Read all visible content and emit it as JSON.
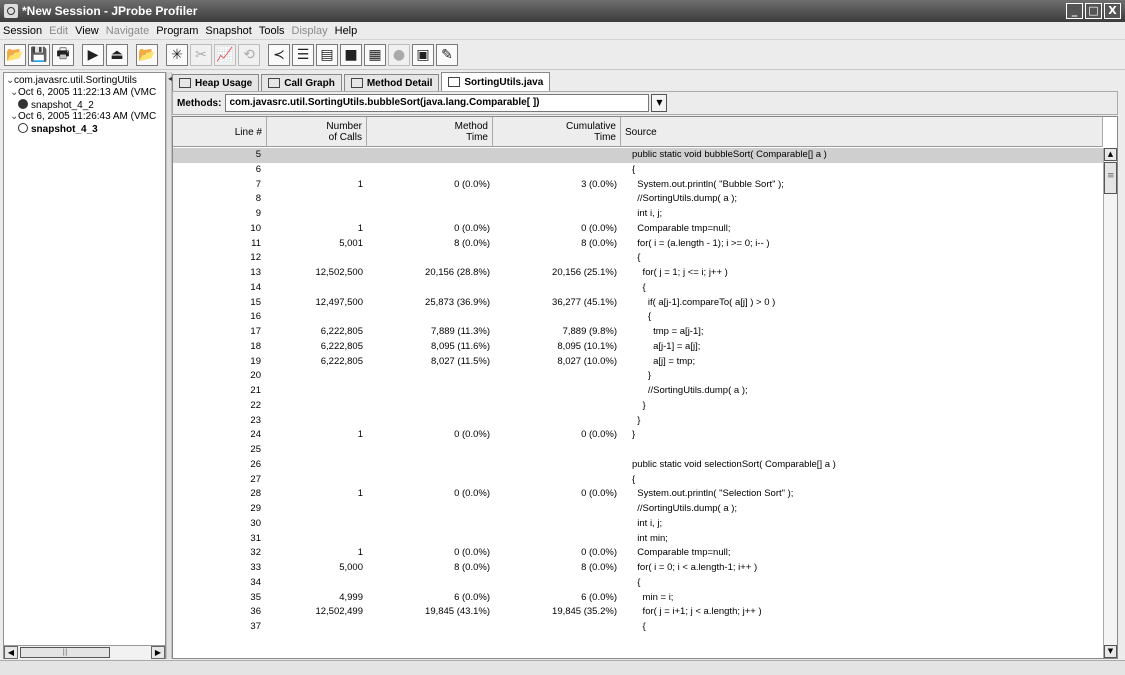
{
  "window": {
    "title": "*New Session - JProbe Profiler",
    "buttons": [
      "_",
      "□",
      "X"
    ]
  },
  "menu": [
    {
      "label": "Session",
      "disabled": false
    },
    {
      "label": "Edit",
      "disabled": true
    },
    {
      "label": "View",
      "disabled": false
    },
    {
      "label": "Navigate",
      "disabled": true
    },
    {
      "label": "Program",
      "disabled": false
    },
    {
      "label": "Snapshot",
      "disabled": false
    },
    {
      "label": "Tools",
      "disabled": false
    },
    {
      "label": "Display",
      "disabled": true
    },
    {
      "label": "Help",
      "disabled": false
    }
  ],
  "toolbar": [
    {
      "icon": "open-folder-icon",
      "glyph": "📂",
      "disabled": false
    },
    {
      "icon": "save-icon",
      "glyph": "💾",
      "disabled": false
    },
    {
      "icon": "print-icon",
      "glyph": "🖶",
      "disabled": false
    },
    {
      "icon": "play-icon",
      "glyph": "▶",
      "disabled": false
    },
    {
      "icon": "eject-icon",
      "glyph": "⏏",
      "disabled": false
    },
    {
      "icon": "open-snapshot-icon",
      "glyph": "📂",
      "disabled": false
    },
    {
      "icon": "garbage-collect-icon",
      "glyph": "✳",
      "disabled": false
    },
    {
      "icon": "scissors-icon",
      "glyph": "✂",
      "disabled": true
    },
    {
      "icon": "heap-chart-icon",
      "glyph": "📈",
      "disabled": true
    },
    {
      "icon": "refresh-icon",
      "glyph": "⟲",
      "disabled": true
    },
    {
      "icon": "call-graph-icon",
      "glyph": "≺",
      "disabled": false
    },
    {
      "icon": "list-icon",
      "glyph": "☰",
      "disabled": false
    },
    {
      "icon": "method-detail-icon",
      "glyph": "▤",
      "disabled": false
    },
    {
      "icon": "memory-icon",
      "glyph": "■",
      "disabled": false
    },
    {
      "icon": "report-icon",
      "glyph": "▦",
      "disabled": false
    },
    {
      "icon": "bulb-icon",
      "glyph": "●",
      "disabled": true
    },
    {
      "icon": "source-icon",
      "glyph": "▣",
      "disabled": false
    },
    {
      "icon": "edit-icon",
      "glyph": "✎",
      "disabled": false
    }
  ],
  "tree": {
    "root": "com.javasrc.util.SortingUtils",
    "sessions": [
      {
        "label": "Oct 6, 2005 11:22:13 AM  (VMC",
        "snapshot": "snapshot_4_2",
        "selected": false
      },
      {
        "label": "Oct 6, 2005 11:26:43 AM  (VMC",
        "snapshot": "snapshot_4_3",
        "selected": true
      }
    ]
  },
  "tabs": [
    {
      "label": "Heap Usage",
      "icon": "heap-usage-icon",
      "active": false
    },
    {
      "label": "Call Graph",
      "icon": "call-graph-icon",
      "active": false
    },
    {
      "label": "Method Detail",
      "icon": "method-detail-icon",
      "active": false
    },
    {
      "label": "SortingUtils.java",
      "icon": "source-file-icon",
      "active": true
    }
  ],
  "methods": {
    "label": "Methods:",
    "selected": "com.javasrc.util.SortingUtils.bubbleSort(java.lang.Comparable[ ])"
  },
  "table": {
    "columns": [
      "Line #",
      "Number\nof Calls",
      "Method\nTime",
      "Cumulative\nTime",
      "Source"
    ],
    "rows": [
      {
        "line": "5",
        "calls": "",
        "mtime": "",
        "ctime": "",
        "src": "public static void bubbleSort( Comparable[] a )",
        "hl": true
      },
      {
        "line": "6",
        "calls": "",
        "mtime": "",
        "ctime": "",
        "src": "{"
      },
      {
        "line": "7",
        "calls": "1",
        "mtime": "0  (0.0%)",
        "ctime": "3  (0.0%)",
        "src": "  System.out.println( \"Bubble Sort\" );"
      },
      {
        "line": "8",
        "calls": "",
        "mtime": "",
        "ctime": "",
        "src": "  //SortingUtils.dump( a );"
      },
      {
        "line": "9",
        "calls": "",
        "mtime": "",
        "ctime": "",
        "src": "  int i, j;"
      },
      {
        "line": "10",
        "calls": "1",
        "mtime": "0  (0.0%)",
        "ctime": "0  (0.0%)",
        "src": "  Comparable tmp=null;"
      },
      {
        "line": "11",
        "calls": "5,001",
        "mtime": "8  (0.0%)",
        "ctime": "8  (0.0%)",
        "src": "  for( i = (a.length - 1); i >= 0; i-- )"
      },
      {
        "line": "12",
        "calls": "",
        "mtime": "",
        "ctime": "",
        "src": "  {"
      },
      {
        "line": "13",
        "calls": "12,502,500",
        "mtime": "20,156  (28.8%)",
        "ctime": "20,156  (25.1%)",
        "src": "    for( j = 1; j <= i; j++ )"
      },
      {
        "line": "14",
        "calls": "",
        "mtime": "",
        "ctime": "",
        "src": "    {"
      },
      {
        "line": "15",
        "calls": "12,497,500",
        "mtime": "25,873  (36.9%)",
        "ctime": "36,277  (45.1%)",
        "src": "      if( a[j-1].compareTo( a[j] ) > 0 )"
      },
      {
        "line": "16",
        "calls": "",
        "mtime": "",
        "ctime": "",
        "src": "      {"
      },
      {
        "line": "17",
        "calls": "6,222,805",
        "mtime": "7,889  (11.3%)",
        "ctime": "7,889  (9.8%)",
        "src": "        tmp = a[j-1];"
      },
      {
        "line": "18",
        "calls": "6,222,805",
        "mtime": "8,095  (11.6%)",
        "ctime": "8,095  (10.1%)",
        "src": "        a[j-1] = a[j];"
      },
      {
        "line": "19",
        "calls": "6,222,805",
        "mtime": "8,027  (11.5%)",
        "ctime": "8,027  (10.0%)",
        "src": "        a[j] = tmp;"
      },
      {
        "line": "20",
        "calls": "",
        "mtime": "",
        "ctime": "",
        "src": "      }"
      },
      {
        "line": "21",
        "calls": "",
        "mtime": "",
        "ctime": "",
        "src": "      //SortingUtils.dump( a );"
      },
      {
        "line": "22",
        "calls": "",
        "mtime": "",
        "ctime": "",
        "src": "    }"
      },
      {
        "line": "23",
        "calls": "",
        "mtime": "",
        "ctime": "",
        "src": "  }"
      },
      {
        "line": "24",
        "calls": "1",
        "mtime": "0  (0.0%)",
        "ctime": "0  (0.0%)",
        "src": "}"
      },
      {
        "line": "25",
        "calls": "",
        "mtime": "",
        "ctime": "",
        "src": ""
      },
      {
        "line": "26",
        "calls": "",
        "mtime": "",
        "ctime": "",
        "src": "public static void selectionSort( Comparable[] a )"
      },
      {
        "line": "27",
        "calls": "",
        "mtime": "",
        "ctime": "",
        "src": "{"
      },
      {
        "line": "28",
        "calls": "1",
        "mtime": "0  (0.0%)",
        "ctime": "0  (0.0%)",
        "src": "  System.out.println( \"Selection Sort\" );"
      },
      {
        "line": "29",
        "calls": "",
        "mtime": "",
        "ctime": "",
        "src": "  //SortingUtils.dump( a );"
      },
      {
        "line": "30",
        "calls": "",
        "mtime": "",
        "ctime": "",
        "src": "  int i, j;"
      },
      {
        "line": "31",
        "calls": "",
        "mtime": "",
        "ctime": "",
        "src": "  int min;"
      },
      {
        "line": "32",
        "calls": "1",
        "mtime": "0  (0.0%)",
        "ctime": "0  (0.0%)",
        "src": "  Comparable tmp=null;"
      },
      {
        "line": "33",
        "calls": "5,000",
        "mtime": "8  (0.0%)",
        "ctime": "8  (0.0%)",
        "src": "  for( i = 0; i < a.length-1; i++ )"
      },
      {
        "line": "34",
        "calls": "",
        "mtime": "",
        "ctime": "",
        "src": "  {"
      },
      {
        "line": "35",
        "calls": "4,999",
        "mtime": "6  (0.0%)",
        "ctime": "6  (0.0%)",
        "src": "    min = i;"
      },
      {
        "line": "36",
        "calls": "12,502,499",
        "mtime": "19,845  (43.1%)",
        "ctime": "19,845  (35.2%)",
        "src": "    for( j = i+1; j < a.length; j++ )"
      },
      {
        "line": "37",
        "calls": "",
        "mtime": "",
        "ctime": "",
        "src": "    {"
      }
    ]
  }
}
